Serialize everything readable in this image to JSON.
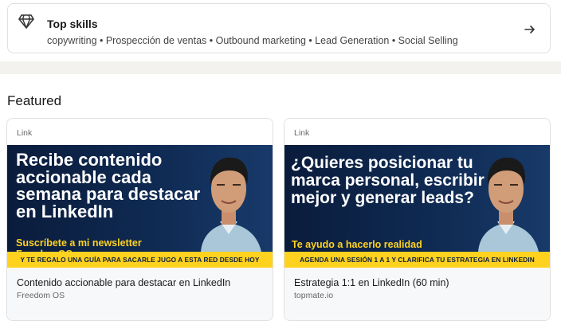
{
  "skills": {
    "icon": "diamond-icon",
    "title": "Top skills",
    "list": "copywriting • Prospección de ventas • Outbound marketing • Lead Generation • Social Selling",
    "arrow_icon": "arrow-right-icon"
  },
  "featured": {
    "title": "Featured",
    "cards": [
      {
        "type": "Link",
        "headline": "Recibe contenido accionable cada semana para destacar en LinkedIn",
        "sub": "Suscríbete a mi newsletter FreedomOS",
        "strip": "Y TE REGALO UNA GUÍA PARA SACARLE JUGO A ESTA RED DESDE HOY",
        "title": "Contenido accionable para destacar en LinkedIn",
        "source": "Freedom OS"
      },
      {
        "type": "Link",
        "headline": "¿Quieres posicionar tu marca personal, escribir mejor y generar leads?",
        "sub": "Te ayudo a hacerlo realidad",
        "strip": "AGENDA UNA SESIÓN 1 A 1 Y CLARIFICA TU ESTRATEGIA EN LINKEDIN",
        "title": "Estrategia 1:1 en LinkedIn (60 min)",
        "source": "topmate.io"
      }
    ]
  },
  "colors": {
    "banner_bg": "#0f2a52",
    "accent_yellow": "#ffd21f",
    "page_band": "#f3f2ef"
  }
}
